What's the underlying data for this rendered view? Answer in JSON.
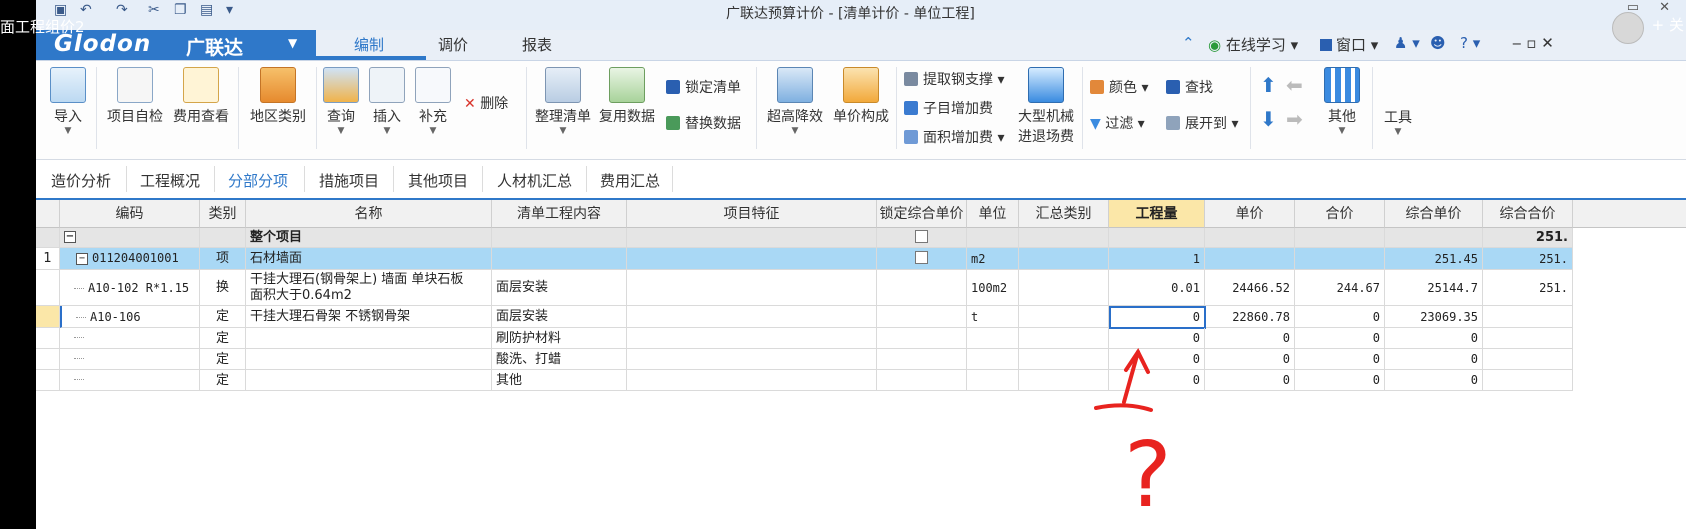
{
  "overlay": {
    "video_title": "面工程组价2",
    "top_right": "+ 关"
  },
  "window": {
    "title": "广联达预算计价 - [清单计价 - 单位工程]"
  },
  "menubar": {
    "brand": "Glodon",
    "brand_cn": "广联达",
    "tabs": [
      "编制",
      "调价",
      "报表"
    ],
    "online_learning": "在线学习",
    "window_menu": "窗口"
  },
  "ribbon": {
    "import": "导入",
    "self_check": "项目自检",
    "fee_view": "费用查看",
    "region": "地区类别",
    "query": "查询",
    "insert": "插入",
    "supplement": "补充",
    "delete": "删除",
    "organize_list": "整理清单",
    "reuse_data": "复用数据",
    "lock_list": "锁定清单",
    "replace_data": "替换数据",
    "super_high": "超高降效",
    "unit_price_comp": "单价构成",
    "extract_support": "提取钢支撑",
    "sub_fee": "子目增加费",
    "area_fee": "面积增加费",
    "machinery_line1": "大型机械",
    "machinery_line2": "进退场费",
    "color": "颜色",
    "find": "查找",
    "filter": "过滤",
    "expand_to": "展开到",
    "other": "其他",
    "tools": "工具"
  },
  "subtabs": [
    "造价分析",
    "工程概况",
    "分部分项",
    "措施项目",
    "其他项目",
    "人材机汇总",
    "费用汇总"
  ],
  "table": {
    "headers": [
      "编码",
      "类别",
      "名称",
      "清单工程内容",
      "项目特征",
      "锁定综合单价",
      "单位",
      "汇总类别",
      "工程量",
      "单价",
      "合价",
      "综合单价",
      "综合合价"
    ],
    "total_row": {
      "name": "整个项目",
      "total": "251."
    },
    "rows": [
      {
        "no": "1",
        "code": "011204001001",
        "type": "项",
        "name": "石材墙面",
        "content": "",
        "unit": "m2",
        "qty": "1",
        "price": "",
        "sum": "",
        "unit_total": "251.45",
        "total": "251."
      },
      {
        "no": "",
        "code": "A10-102 R*1.15",
        "type": "换",
        "name1": "干挂大理石(钢骨架上) 墙面  单块石板",
        "name2": "面积大于0.64m2",
        "content": "面层安装",
        "unit": "100m2",
        "qty": "0.01",
        "price": "24466.52",
        "sum": "244.67",
        "unit_total": "25144.7",
        "total": "251."
      },
      {
        "no": "",
        "code": "A10-106",
        "type": "定",
        "name": "干挂大理石骨架 不锈钢骨架",
        "content": "面层安装",
        "unit": "t",
        "qty": "0",
        "price": "22860.78",
        "sum": "0",
        "unit_total": "23069.35",
        "total": ""
      },
      {
        "no": "",
        "code": "",
        "type": "定",
        "name": "",
        "content": "刷防护材料",
        "unit": "",
        "qty": "0",
        "price": "0",
        "sum": "0",
        "unit_total": "0",
        "total": ""
      },
      {
        "no": "",
        "code": "",
        "type": "定",
        "name": "",
        "content": "酸洗、打蜡",
        "unit": "",
        "qty": "0",
        "price": "0",
        "sum": "0",
        "unit_total": "0",
        "total": ""
      },
      {
        "no": "",
        "code": "",
        "type": "定",
        "name": "",
        "content": "其他",
        "unit": "",
        "qty": "0",
        "price": "0",
        "sum": "0",
        "unit_total": "0",
        "total": ""
      }
    ]
  },
  "annotation": {
    "symbol": "?"
  }
}
